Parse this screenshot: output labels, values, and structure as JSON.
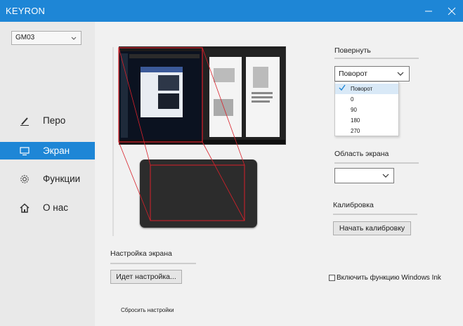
{
  "window": {
    "title": "KEYRON"
  },
  "sidebar": {
    "model": "GM03",
    "items": [
      {
        "label": "Перо",
        "icon": "pen-icon",
        "active": false
      },
      {
        "label": "Экран",
        "icon": "screen-icon",
        "active": true
      },
      {
        "label": "Функции",
        "icon": "gear-icon",
        "active": false
      },
      {
        "label": "О нас",
        "icon": "home-icon",
        "active": false
      }
    ]
  },
  "rotate": {
    "label": "Повернуть",
    "selected": "Поворот",
    "options": [
      "Поворот",
      "0",
      "90",
      "180",
      "270"
    ]
  },
  "screen_area": {
    "label": "Область экрана",
    "selected": ""
  },
  "calibration": {
    "label": "Калибровка",
    "button": "Начать калибровку"
  },
  "screen_setup": {
    "label": "Настройка экрана",
    "button": "Идет настройка..."
  },
  "windows_ink": {
    "label": "Включить функцию Windows Ink",
    "checked": false
  },
  "reset": {
    "label": "Сбросить настройки"
  },
  "colors": {
    "accent": "#1e86d6",
    "mapping_lines": "#d9202a",
    "tablet": "#2c2c2c"
  }
}
